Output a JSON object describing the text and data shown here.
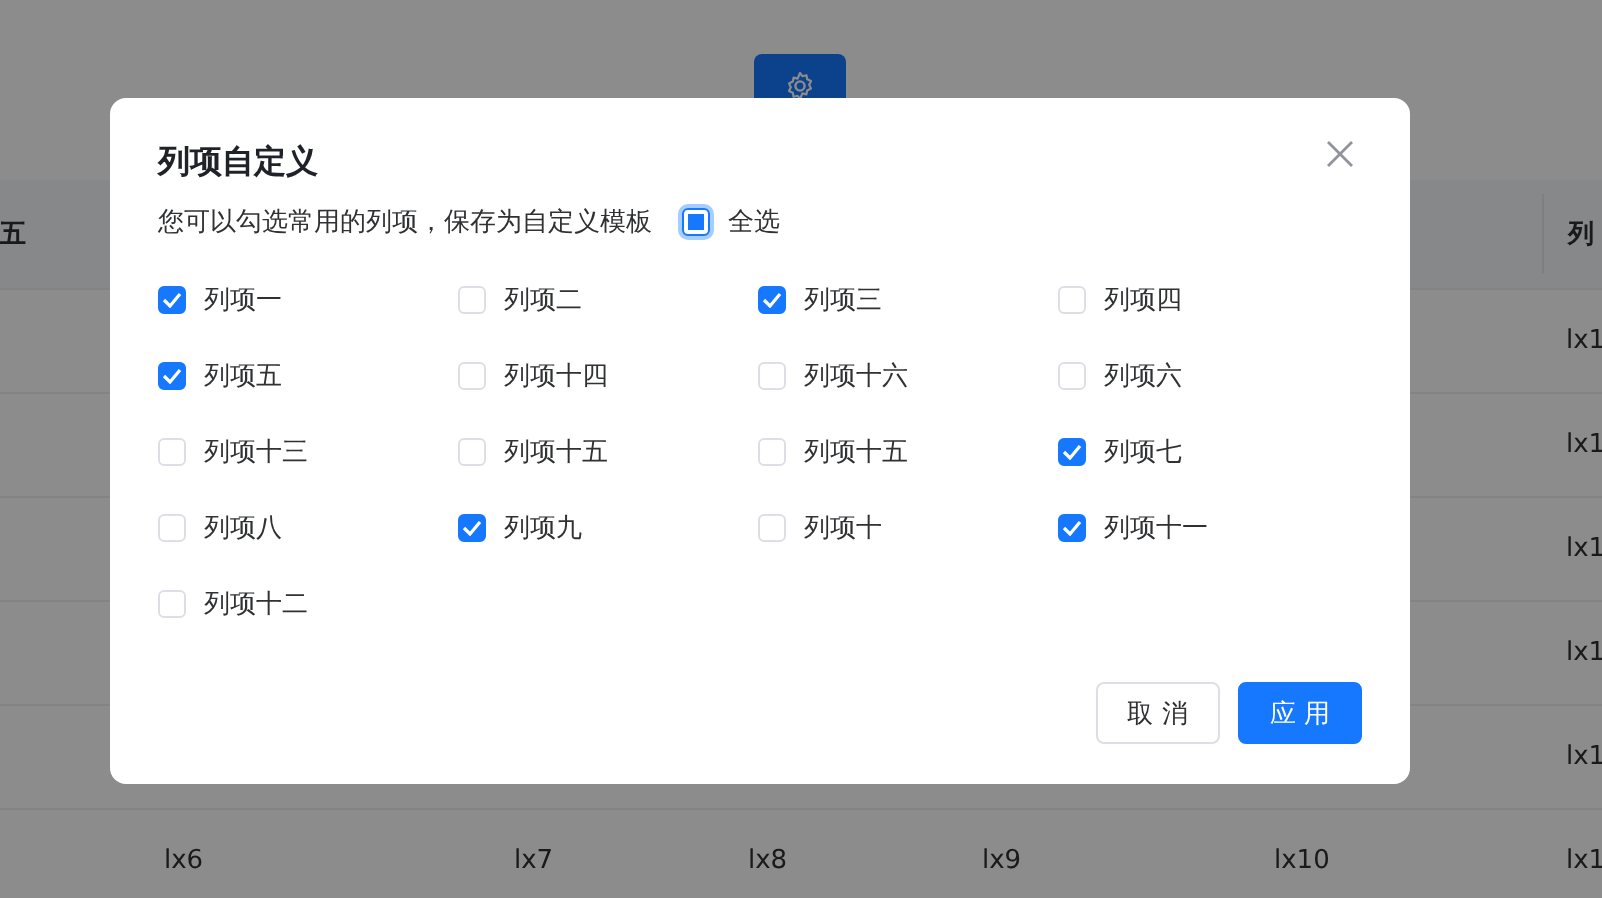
{
  "table": {
    "columns": [
      "五",
      null,
      null,
      null,
      null,
      null,
      "列"
    ],
    "rows": [
      [
        null,
        null,
        null,
        null,
        null,
        null,
        "lx1"
      ],
      [
        null,
        null,
        null,
        null,
        null,
        null,
        "lx1"
      ],
      [
        null,
        null,
        null,
        null,
        null,
        null,
        "lx1"
      ],
      [
        null,
        null,
        null,
        null,
        null,
        null,
        "lx1"
      ],
      [
        null,
        null,
        null,
        null,
        null,
        null,
        "lx1"
      ],
      [
        null,
        "lx6",
        "lx7",
        "lx8",
        "lx9",
        "lx10",
        "lx1"
      ]
    ]
  },
  "dialog": {
    "title": "列项自定义",
    "description": "您可以勾选常用的列项，保存为自定义模板",
    "select_all": {
      "label": "全选",
      "indeterminate": true
    },
    "options": [
      {
        "label": "列项一",
        "checked": true
      },
      {
        "label": "列项二",
        "checked": false
      },
      {
        "label": "列项三",
        "checked": true
      },
      {
        "label": "列项四",
        "checked": false
      },
      {
        "label": "列项五",
        "checked": true
      },
      {
        "label": "列项十四",
        "checked": false
      },
      {
        "label": "列项十六",
        "checked": false
      },
      {
        "label": "列项六",
        "checked": false
      },
      {
        "label": "列项十三",
        "checked": false
      },
      {
        "label": "列项十五",
        "checked": false
      },
      {
        "label": "列项十五",
        "checked": false
      },
      {
        "label": "列项七",
        "checked": true
      },
      {
        "label": "列项八",
        "checked": false
      },
      {
        "label": "列项九",
        "checked": true
      },
      {
        "label": "列项十",
        "checked": false
      },
      {
        "label": "列项十一",
        "checked": true
      },
      {
        "label": "列项十二",
        "checked": false
      }
    ],
    "buttons": [
      {
        "label": "取 消",
        "kind": "secondary"
      },
      {
        "label": "应 用",
        "kind": "primary"
      }
    ]
  }
}
